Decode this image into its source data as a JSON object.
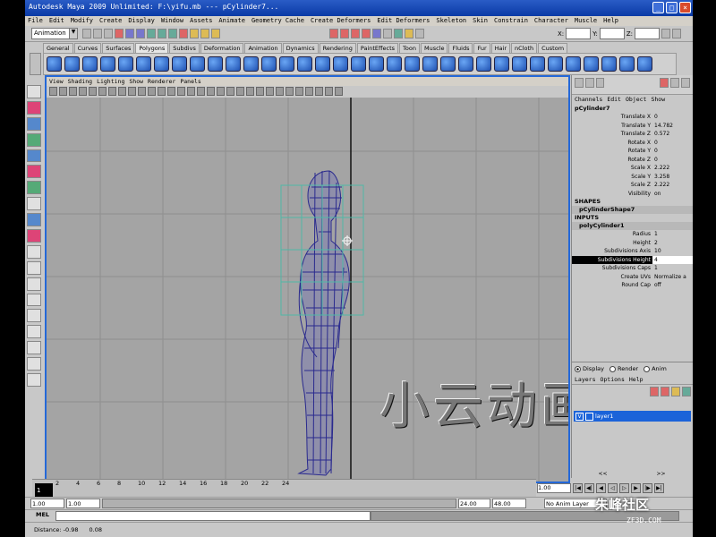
{
  "window": {
    "title": "Autodesk Maya 2009 Unlimited: F:\\yifu.mb   ---   pCylinder7...",
    "min": "_",
    "max": "□",
    "close": "×"
  },
  "menu": [
    "File",
    "Edit",
    "Modify",
    "Create",
    "Display",
    "Window",
    "Assets",
    "Animate",
    "Geometry Cache",
    "Create Deformers",
    "Edit Deformers",
    "Skeleton",
    "Skin",
    "Constrain",
    "Character",
    "Muscle",
    "Help"
  ],
  "status": {
    "mode": "Animation",
    "x_label": "X:",
    "y_label": "Y:",
    "z_label": "Z:"
  },
  "shelf_tabs": [
    "General",
    "Curves",
    "Surfaces",
    "Polygons",
    "Subdivs",
    "Deformation",
    "Animation",
    "Dynamics",
    "Rendering",
    "PaintEffects",
    "Toon",
    "Muscle",
    "Fluids",
    "Fur",
    "Hair",
    "nCloth",
    "Custom"
  ],
  "shelf_active": "Polygons",
  "panel_menu": [
    "View",
    "Shading",
    "Lighting",
    "Show",
    "Renderer",
    "Panels"
  ],
  "channel_box": {
    "menu": [
      "Channels",
      "Edit",
      "Object",
      "Show"
    ],
    "object": "pCylinder7",
    "attributes": [
      {
        "k": "Translate X",
        "v": "0"
      },
      {
        "k": "Translate Y",
        "v": "14.782"
      },
      {
        "k": "Translate Z",
        "v": "0.572"
      },
      {
        "k": "Rotate X",
        "v": "0"
      },
      {
        "k": "Rotate Y",
        "v": "0"
      },
      {
        "k": "Rotate Z",
        "v": "0"
      },
      {
        "k": "Scale X",
        "v": "2.222"
      },
      {
        "k": "Scale Y",
        "v": "3.258"
      },
      {
        "k": "Scale Z",
        "v": "2.222"
      },
      {
        "k": "Visibility",
        "v": "on"
      }
    ],
    "shapes_label": "SHAPES",
    "shape_name": "pCylinderShape7",
    "inputs_label": "INPUTS",
    "input_name": "polyCylinder1",
    "input_attrs": [
      {
        "k": "Radius",
        "v": "1"
      },
      {
        "k": "Height",
        "v": "2"
      },
      {
        "k": "Subdivisions Axis",
        "v": "10"
      },
      {
        "k": "Subdivisions Height",
        "v": "4",
        "hl": true
      },
      {
        "k": "Subdivisions Caps",
        "v": "1"
      },
      {
        "k": "Create UVs",
        "v": "Normalize a"
      },
      {
        "k": "Round Cap",
        "v": "off"
      }
    ]
  },
  "layers": {
    "modes": [
      "Display",
      "Render",
      "Anim"
    ],
    "menu": [
      "Layers",
      "Options",
      "Help"
    ],
    "layer_name": "layer1",
    "visible": "V",
    "scroll_left": "<<",
    "scroll_right": ">>"
  },
  "timeline": {
    "ticks": [
      "2",
      "4",
      "6",
      "8",
      "10",
      "12",
      "14",
      "16",
      "18",
      "20",
      "22",
      "24"
    ],
    "current": "1"
  },
  "playback": {
    "current": "1.00"
  },
  "range": {
    "start": "1.00",
    "start2": "1.00",
    "end": "24.00",
    "end2": "48.00",
    "anim_layer": "No Anim Layer"
  },
  "cmd": {
    "label": "MEL"
  },
  "help": {
    "distance_label": "Distance: -0.98",
    "value2": "0.08"
  },
  "overlay": "小云动画",
  "watermark": {
    "main": "朱峰社区",
    "sub": "ZF3D.COM"
  }
}
